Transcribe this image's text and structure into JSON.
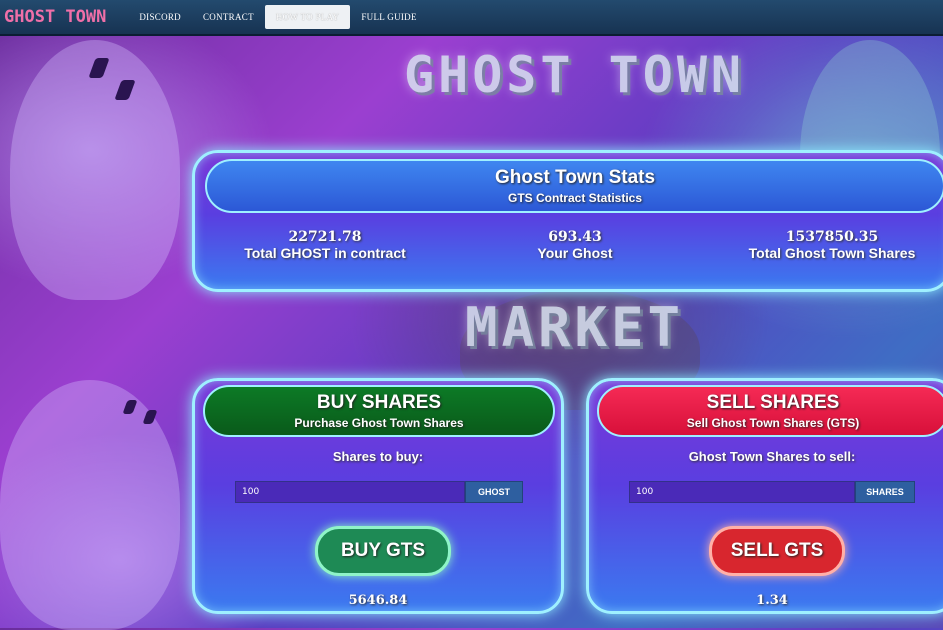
{
  "nav": {
    "brand": "GHOST TOWN",
    "links": [
      "DISCORD",
      "CONTRACT",
      "HOW TO PLAY",
      "FULL GUIDE"
    ]
  },
  "banner_title": "GHOST TOWN",
  "market_title": "MARKET",
  "stats": {
    "title": "Ghost Town Stats",
    "subtitle": "GTS Contract Statistics",
    "items": [
      {
        "value": "22721.78",
        "label": "Total GHOST in contract"
      },
      {
        "value": "693.43",
        "label": "Your Ghost"
      },
      {
        "value": "1537850.35",
        "label": "Total Ghost Town Shares"
      }
    ]
  },
  "buy": {
    "title": "BUY SHARES",
    "subtitle": "Purchase Ghost Town Shares",
    "field_label": "Shares to buy:",
    "input_value": "100",
    "addon": "GHOST",
    "button": "BUY GTS",
    "result": "5646.84"
  },
  "sell": {
    "title": "SELL SHARES",
    "subtitle": "Sell Ghost Town Shares (GTS)",
    "field_label": "Ghost Town Shares to sell:",
    "input_value": "100",
    "addon": "SHARES",
    "button": "SELL GTS",
    "result": "1.34"
  },
  "colors": {
    "buy_header": "#0e6b22",
    "sell_header": "#ef1c45",
    "buy_button": "#1e8a55",
    "sell_button": "#d8262e",
    "panel_border": "#9ff0ff"
  }
}
